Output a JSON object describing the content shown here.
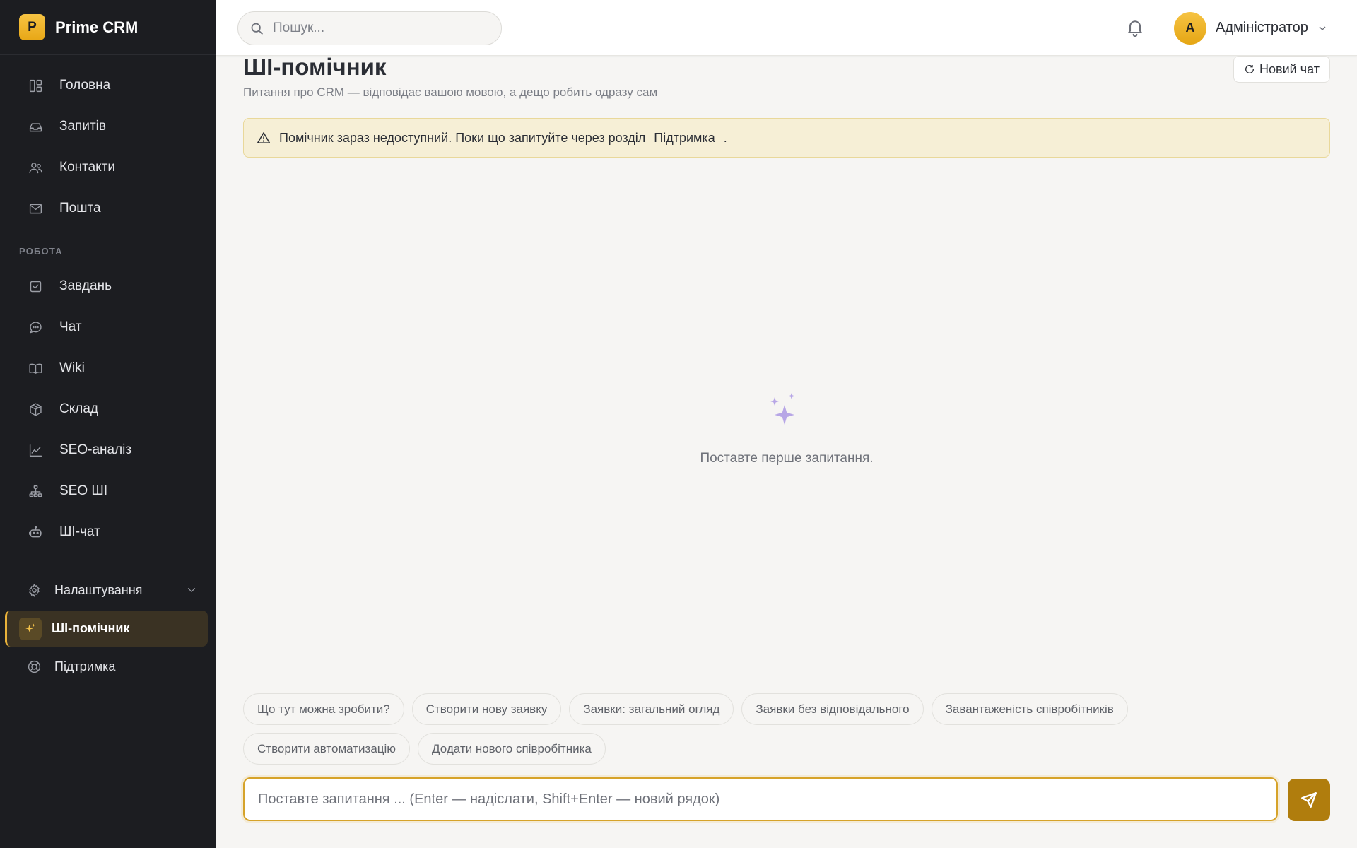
{
  "brand": {
    "logo_letter": "P",
    "name": "Prime CRM"
  },
  "sidebar": {
    "main_items": [
      {
        "label": "Головна",
        "icon": "dashboard-icon"
      },
      {
        "label": "Запитів",
        "icon": "inbox-icon"
      },
      {
        "label": "Контакти",
        "icon": "contacts-icon"
      },
      {
        "label": "Пошта",
        "icon": "mail-icon"
      }
    ],
    "section_title": "РОБОТА",
    "work_items": [
      {
        "label": "Завдань",
        "icon": "checkbox-icon"
      },
      {
        "label": "Чат",
        "icon": "chat-bubble-icon"
      },
      {
        "label": "Wiki",
        "icon": "book-icon"
      },
      {
        "label": "Склад",
        "icon": "box-icon"
      },
      {
        "label": "SEO-аналіз",
        "icon": "chart-line-icon"
      },
      {
        "label": "SEO ШІ",
        "icon": "sitemap-icon"
      },
      {
        "label": "ШІ-чат",
        "icon": "robot-icon"
      }
    ],
    "settings_label": "Налаштування",
    "active_label": "ШІ-помічник",
    "support_label": "Підтримка"
  },
  "topbar": {
    "search_placeholder": "Пошук...",
    "user_initial": "A",
    "user_name": "Адміністратор"
  },
  "main": {
    "title": "ШІ-помічник",
    "subtitle": "Питання про CRM — відповідає вашою мовою, а дещо робить одразу сам",
    "new_chat_label": "Новий чат",
    "alert_text": "Помічник зараз недоступний. Поки що запитуйте через розділ",
    "alert_link": "Підтримка",
    "alert_end": ".",
    "empty_text": "Поставте перше запитання.",
    "suggestions_row1": [
      "Що тут можна зробити?",
      "Створити нову заявку",
      "Заявки: загальний огляд",
      "Заявки без відповідального",
      "Завантаженість співробітників"
    ],
    "suggestions_row2": [
      "Створити автоматизацію",
      "Додати нового співробітника"
    ],
    "composer_placeholder": "Поставте запитання ... (Enter — надіслати, Shift+Enter — новий рядок)"
  },
  "colors": {
    "sidebar_bg": "#1c1d21",
    "accent": "#e9b23a",
    "send_button": "#b07d0d",
    "alert_bg": "#f6efd6"
  }
}
